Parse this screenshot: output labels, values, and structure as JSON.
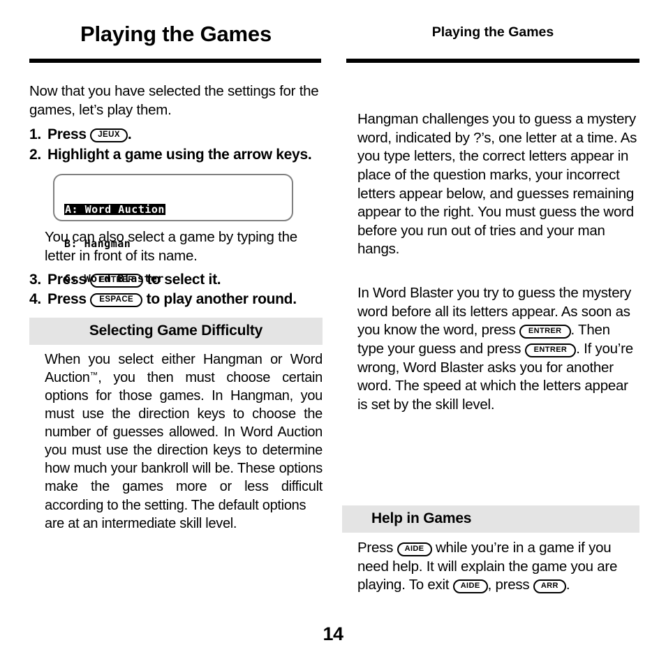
{
  "page": {
    "number": "14",
    "running_head_left": "Playing the Games",
    "running_head_right": "Playing the Games"
  },
  "left_column": {
    "intro": "Now that you have selected the settings for the games, let’s play them.",
    "steps": [
      {
        "num": "1.",
        "pre": "Press",
        "key": "JEUX",
        "post": "."
      },
      {
        "num": "2.",
        "pre": "Highlight a game using the arrow keys.",
        "key": "",
        "post": ""
      },
      {
        "num": "3.",
        "pre": "Press",
        "key": "ENTRER",
        "post": "to select it."
      },
      {
        "num": "4.",
        "pre": "Press",
        "key": "ESPACE",
        "post": "to play another round."
      }
    ],
    "lcd": {
      "line1": "A: Word Auction",
      "line1_selected": true,
      "line2": "B: Hangman",
      "line3": "C: Word Blaster"
    },
    "after_lcd": "You can also select a game by typing the letter in front of its name.",
    "section_heading": "Selecting Game Difficulty",
    "section_body_1": "When you select either Hangman or Word Auction",
    "section_body_tm": "™",
    "section_body_2": ", you then must choose certain options for those games. In Hangman, you must use the direction keys to choose the number of guesses allowed. In Word Auction you must use the direction keys to determine how much your bankroll will be. These options make the games more or less difficult according to the setting. The default options",
    "section_body_3": "are at an intermediate skill level."
  },
  "right_column": {
    "para_hangman": "Hangman challenges you to guess a mystery word, indicated by ?’s, one letter at a time. As you type letters, the correct letters appear in place of the question marks, your incorrect letters appear below, and guesses remaining appear to the right. You must guess the word before you run out of tries and your man hangs.",
    "para_blaster": {
      "part1": "In Word Blaster you try to guess the mystery word before all its letters appear. As soon as you know the word, press",
      "key1": "ENTRER",
      "part2": ". Then type your guess and press",
      "key2": "ENTRER",
      "part3": ". If you’re wrong, Word Blaster asks you for another word. The speed at which the letters appear is set by the skill level."
    },
    "section_heading": "Help in Games",
    "para_help": {
      "part1": "Press",
      "key1": "AIDE",
      "part2": "while you’re in a game if you need help. It will explain the game you are playing. To exit",
      "key2": "AIDE",
      "part3": ",",
      "part4": "press",
      "key3": "ARR",
      "part5": "."
    }
  },
  "colors": {
    "text": "#000000",
    "background": "#ffffff",
    "section_heading_bg": "#e4e4e4",
    "lcd_border": "#808080"
  }
}
